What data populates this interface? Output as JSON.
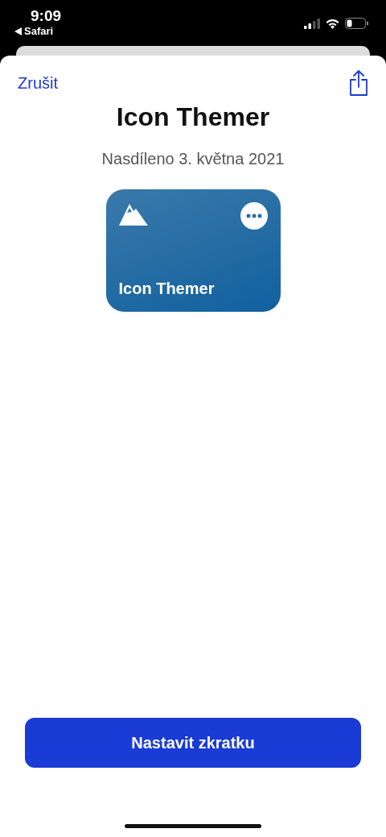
{
  "status_bar": {
    "time": "9:09",
    "back_app": "Safari"
  },
  "nav": {
    "cancel": "Zrušit"
  },
  "title": "Icon Themer",
  "subtitle": "Nasdíleno 3. května 2021",
  "shortcut_card": {
    "name": "Icon Themer"
  },
  "primary_button": "Nastavit zkratku"
}
